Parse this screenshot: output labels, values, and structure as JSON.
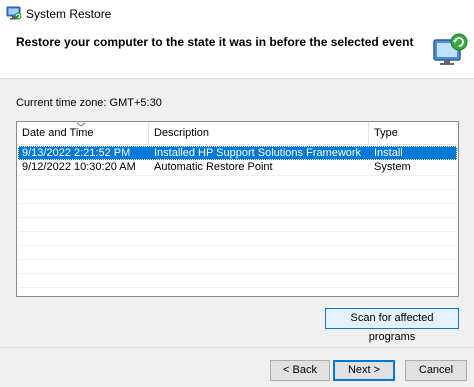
{
  "window": {
    "title": "System Restore",
    "icon": "system-restore-icon"
  },
  "header": {
    "title": "Restore your computer to the state it was in before the selected event",
    "icon": "monitor-restore-icon"
  },
  "timezone": "Current time zone: GMT+5:30",
  "table": {
    "columns": [
      "Date and Time",
      "Description",
      "Type"
    ],
    "sorted_column": "Date and Time",
    "rows": [
      {
        "date": "9/13/2022 2:21:52 PM",
        "description": "Installed HP Support Solutions Framework",
        "type": "Install",
        "selected": true
      },
      {
        "date": "9/12/2022 10:30:20 AM",
        "description": "Automatic Restore Point",
        "type": "System",
        "selected": false
      }
    ]
  },
  "buttons": {
    "scan": "Scan for affected programs",
    "back": "< Back",
    "next": "Next >",
    "cancel": "Cancel"
  },
  "colors": {
    "selection": "#0078d7",
    "button_bg": "#e1e1e1",
    "focus_border": "#0078d7"
  }
}
